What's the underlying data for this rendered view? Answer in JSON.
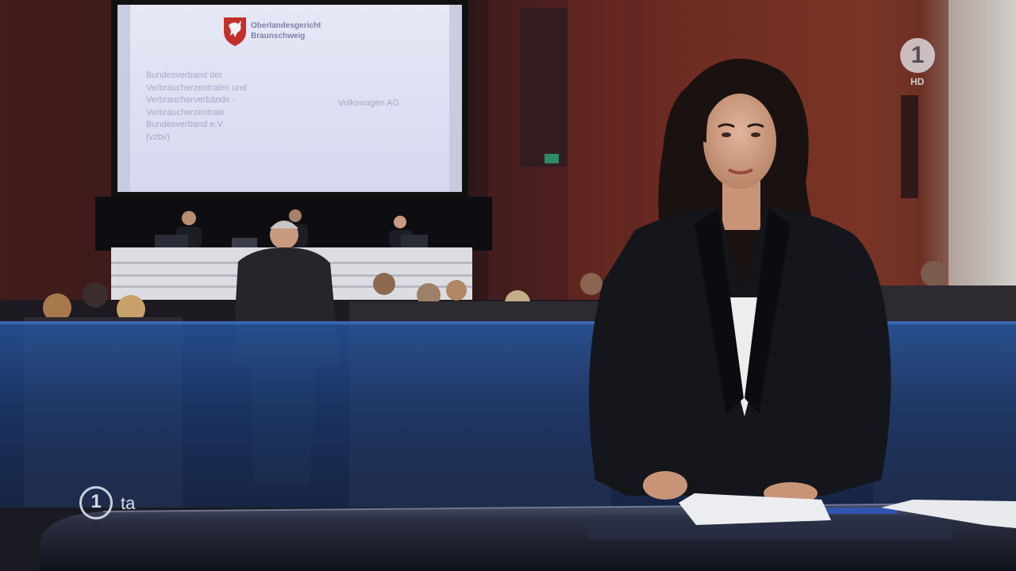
{
  "screen": {
    "court_logo_text": "Oberlandesgericht\nBraunschweig",
    "plaintiff_text": "Bundesverband der\nVerbraucherzentralen und\nVerbraucherverbände -\nVerbraucherzentrale\nBundesverband e.V.\n(vzbv)",
    "defendant_text": "Volkswagen AG"
  },
  "broadcast": {
    "station_logo": "1",
    "station_quality": "HD",
    "program_logo_mark": "1",
    "program_logo_text": "ta"
  },
  "colors": {
    "wall_red": "#6b2a22",
    "band_blue": "#1e4a86",
    "jacket": "#15161c",
    "desk": "#1c2030"
  }
}
